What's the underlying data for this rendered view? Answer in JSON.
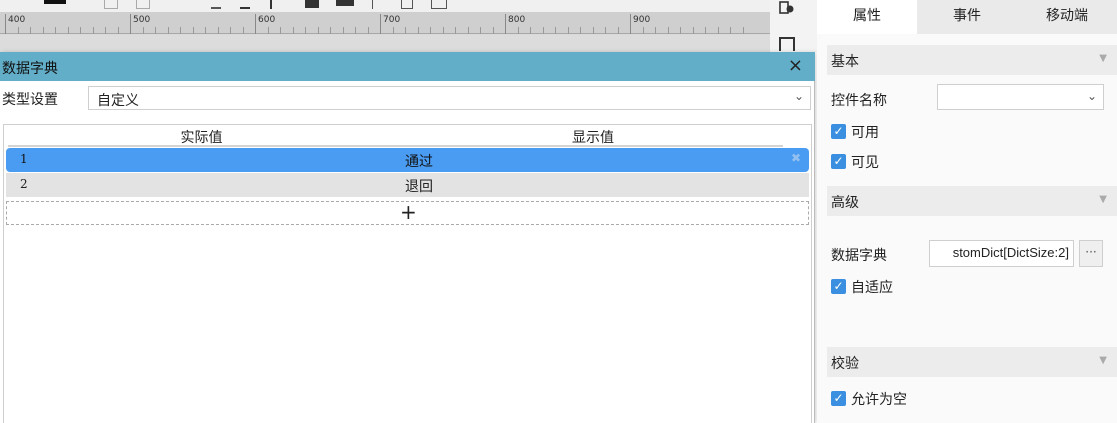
{
  "ruler": {
    "labels": [
      "400",
      "500",
      "600",
      "700",
      "800",
      "900"
    ]
  },
  "dialog": {
    "title": "数据字典",
    "close_glyph": "×",
    "type_label": "类型设置",
    "type_value": "自定义",
    "select_chevron": "⌄",
    "columns": {
      "actual": "实际值",
      "display": "显示值"
    },
    "rows": [
      {
        "actual": "1",
        "display": "通过",
        "selected": true
      },
      {
        "actual": "2",
        "display": "退回",
        "selected": false
      }
    ],
    "delete_glyph": "✖",
    "add_glyph": "+"
  },
  "panel": {
    "tabs": [
      "属性",
      "事件",
      "移动端"
    ],
    "active_tab": "属性",
    "sections": {
      "basic": "基本",
      "advanced": "高级",
      "validation": "校验"
    },
    "caret_glyph": "▼",
    "control_name_label": "控件名称",
    "control_name_value": "",
    "enabled_label": "可用",
    "visible_label": "可见",
    "dict_label": "数据字典",
    "dict_value": "stomDict[DictSize:2]",
    "dict_button": "···",
    "autofit_label": "自适应",
    "allow_empty_label": "允许为空",
    "check_glyph": "✓"
  },
  "colors": {
    "title_bar": "#62aec8",
    "selected_row": "#4a9cf2",
    "checkbox": "#3a8fe0"
  }
}
